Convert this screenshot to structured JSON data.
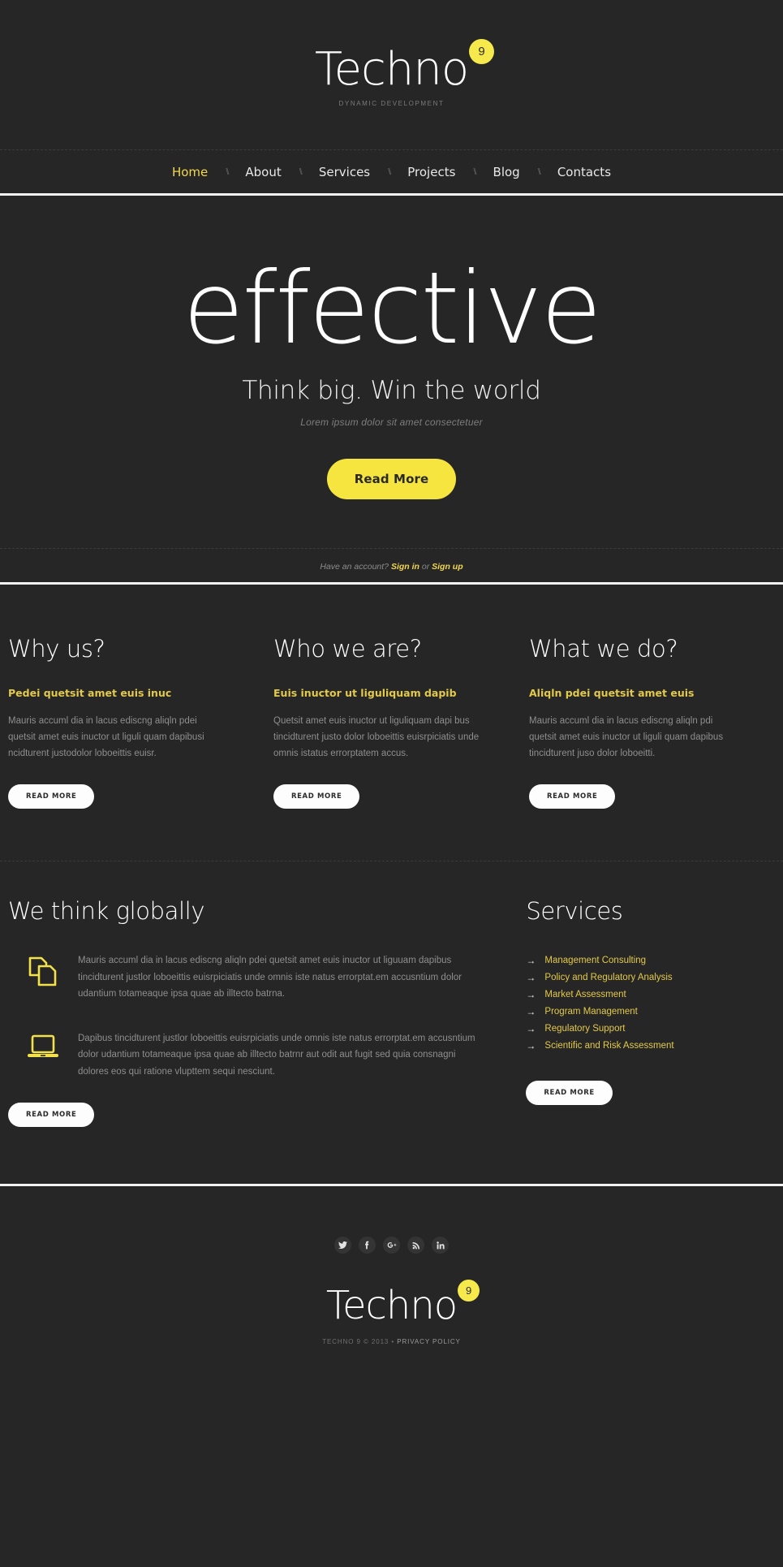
{
  "colors": {
    "background": "#262626",
    "accent_yellow": "#f7e53f",
    "link_yellow": "#e3c94a",
    "nav_active": "#f2d74e",
    "text_white": "#ffffff",
    "text_muted": "#8e8e8e"
  },
  "header": {
    "logo_text": "Techno",
    "logo_badge": "9",
    "tagline": "DYNAMIC DEVELOPMENT"
  },
  "nav": {
    "separator": "\\\\",
    "items": [
      {
        "label": "Home",
        "active": true
      },
      {
        "label": "About",
        "active": false
      },
      {
        "label": "Services",
        "active": false
      },
      {
        "label": "Projects",
        "active": false
      },
      {
        "label": "Blog",
        "active": false
      },
      {
        "label": "Contacts",
        "active": false
      }
    ]
  },
  "hero": {
    "title": "effective",
    "subtitle": "Think big. Win the world",
    "note": "Lorem ipsum dolor sit amet consectetuer",
    "button_label": "Read More"
  },
  "account": {
    "prompt": "Have an account?",
    "sign_in": "Sign in",
    "conjunction": "or",
    "sign_up": "Sign up"
  },
  "columns": [
    {
      "title": "Why us?",
      "subtitle": "Pedei quetsit amet euis inuc",
      "body": "Mauris accuml dia in lacus ediscng aliqln pdei quetsit amet euis inuctor ut liguli quam dapibusi ncidturent justodolor loboeittis euisr.",
      "button_label": "READ MORE"
    },
    {
      "title": "Who we are?",
      "subtitle": "Euis inuctor ut liguliquam dapib",
      "body": "Quetsit amet euis inuctor ut liguliquam dapi bus tincidturent justo dolor loboeittis euisrpiciatis unde omnis istatus errorptatem accus.",
      "button_label": "READ MORE"
    },
    {
      "title": "What we do?",
      "subtitle": "Aliqln pdei quetsit amet euis",
      "body": "Mauris accuml dia in lacus ediscng aliqln pdi quetsit amet euis inuctor ut liguli quam dapibus tincidturent juso dolor loboeitti.",
      "button_label": "READ MORE"
    }
  ],
  "globally": {
    "title": "We think globally",
    "features": [
      {
        "icon": "documents-icon",
        "text": "Mauris accuml dia in lacus ediscng aliqln pdei quetsit amet euis inuctor ut liguuam dapibus tincidturent justlor loboeittis euisrpiciatis unde omnis iste natus errorptat.em accusntium dolor udantium totameaque ipsa quae ab illtecto batrna."
      },
      {
        "icon": "laptop-icon",
        "text": "Dapibus tincidturent justlor loboeittis euisrpiciatis unde omnis iste natus errorptat.em accusntium dolor udantium totameaque ipsa quae ab illtecto batrnr aut odit aut fugit sed quia consnagni dolores eos qui ratione vlupttem sequi nesciunt."
      }
    ],
    "button_label": "READ MORE"
  },
  "services": {
    "title": "Services",
    "arrow": "→",
    "items": [
      "Management Consulting",
      "Policy and Regulatory Analysis",
      "Market Assessment",
      "Program Management",
      "Regulatory Support",
      "Scientific and Risk Assessment"
    ],
    "button_label": "READ MORE"
  },
  "footer": {
    "socials": [
      {
        "name": "twitter-icon",
        "glyph": "t"
      },
      {
        "name": "facebook-icon",
        "glyph": "f"
      },
      {
        "name": "google-plus-icon",
        "glyph": "g+"
      },
      {
        "name": "rss-icon",
        "glyph": "rss"
      },
      {
        "name": "linkedin-icon",
        "glyph": "in"
      }
    ],
    "logo_text": "Techno",
    "logo_badge": "9",
    "copyright": "TECHNO 9 © 2013 • ",
    "privacy_policy": "PRIVACY POLICY"
  }
}
